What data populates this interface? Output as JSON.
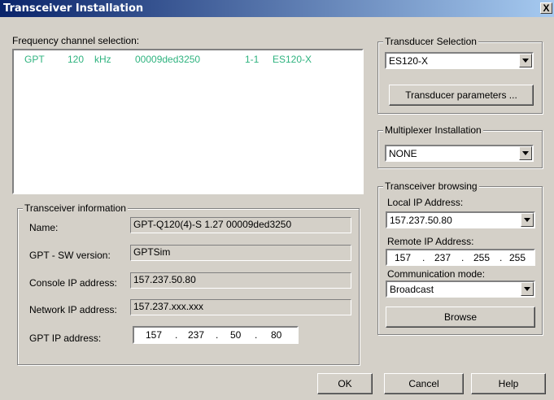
{
  "window": {
    "title": "Transceiver Installation",
    "close": "X"
  },
  "frequency": {
    "label": "Frequency channel selection:",
    "rows": [
      {
        "name": "GPT",
        "freq": "120",
        "unit": "kHz",
        "serial": "00009ded3250",
        "channel": "1-1",
        "transducer": "ES120-X"
      }
    ]
  },
  "info": {
    "title": "Transceiver information",
    "name_label": "Name:",
    "name_value": "GPT-Q120(4)-S 1.27 00009ded3250",
    "sw_label": "GPT - SW version:",
    "sw_value": "GPTSim",
    "console_label": "Console IP address:",
    "console_value": "157.237.50.80",
    "network_label": "Network IP address:",
    "network_value": "157.237.xxx.xxx",
    "gptip_label": "GPT IP address:",
    "gptip": [
      "157",
      "237",
      "50",
      "80"
    ]
  },
  "transducer": {
    "title": "Transducer Selection",
    "selected": "ES120-X",
    "params_button": "Transducer parameters ..."
  },
  "multiplexer": {
    "title": "Multiplexer Installation",
    "selected": "NONE"
  },
  "browsing": {
    "title": "Transceiver browsing",
    "local_label": "Local IP Address:",
    "local_value": "157.237.50.80",
    "remote_label": "Remote IP Address:",
    "remote": [
      "157",
      "237",
      "255",
      "255"
    ],
    "mode_label": "Communication mode:",
    "mode_value": "Broadcast",
    "browse_button": "Browse"
  },
  "buttons": {
    "ok": "OK",
    "cancel": "Cancel",
    "help": "Help"
  }
}
